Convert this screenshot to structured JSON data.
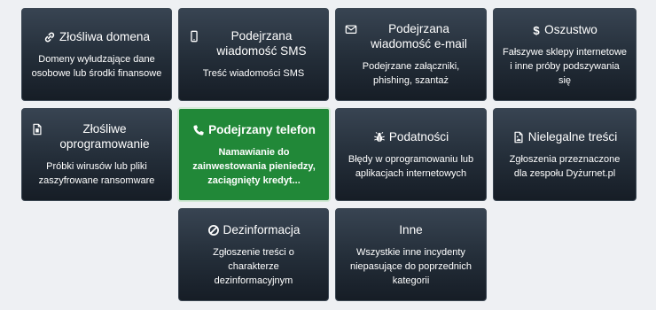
{
  "categories": [
    {
      "title": "Złośliwa domena",
      "description": "Domeny wyłudzające dane osobowe lub środki finansowe",
      "icon": "link-icon"
    },
    {
      "title": "Podejrzana wiadomość SMS",
      "description": "Treść wiadomości SMS",
      "icon": "mobile-phone-icon"
    },
    {
      "title": "Podejrzana wiadomość e-mail",
      "description": "Podejrzane załączniki, phishing, szantaż",
      "icon": "envelope-icon"
    },
    {
      "title": "Oszustwo",
      "description": "Fałszywe sklepy internetowe i inne próby podszywania się",
      "icon": "dollar-icon"
    },
    {
      "title": "Złośliwe oprogramowanie",
      "description": "Próbki wirusów lub pliki zaszyfrowane ransomware",
      "icon": "file-code-icon"
    },
    {
      "title": "Podejrzany telefon",
      "description": "Namawianie do zainwestowania pieniedzy, zaciągnięty kredyt...",
      "icon": "phone-icon",
      "selected": true
    },
    {
      "title": "Podatności",
      "description": "Błędy w oprogramowaniu lub aplikacjach internetowych",
      "icon": "bug-icon"
    },
    {
      "title": "Nielegalne treści",
      "description": "Zgłoszenia przeznaczone dla zespołu Dyżurnet.pl",
      "icon": "image-file-icon"
    },
    {
      "title": "Dezinformacja",
      "description": "Zgłoszenie treści o charakterze dezinformacyjnym",
      "icon": "ban-icon"
    },
    {
      "title": "Inne",
      "description": "Wszystkie inne incydenty niepasujące do poprzednich kategorii",
      "icon": ""
    }
  ],
  "colors": {
    "tile_background": "#232d38",
    "selected_background": "#218838",
    "page_background": "#eef0f3",
    "text": "#ffffff"
  }
}
